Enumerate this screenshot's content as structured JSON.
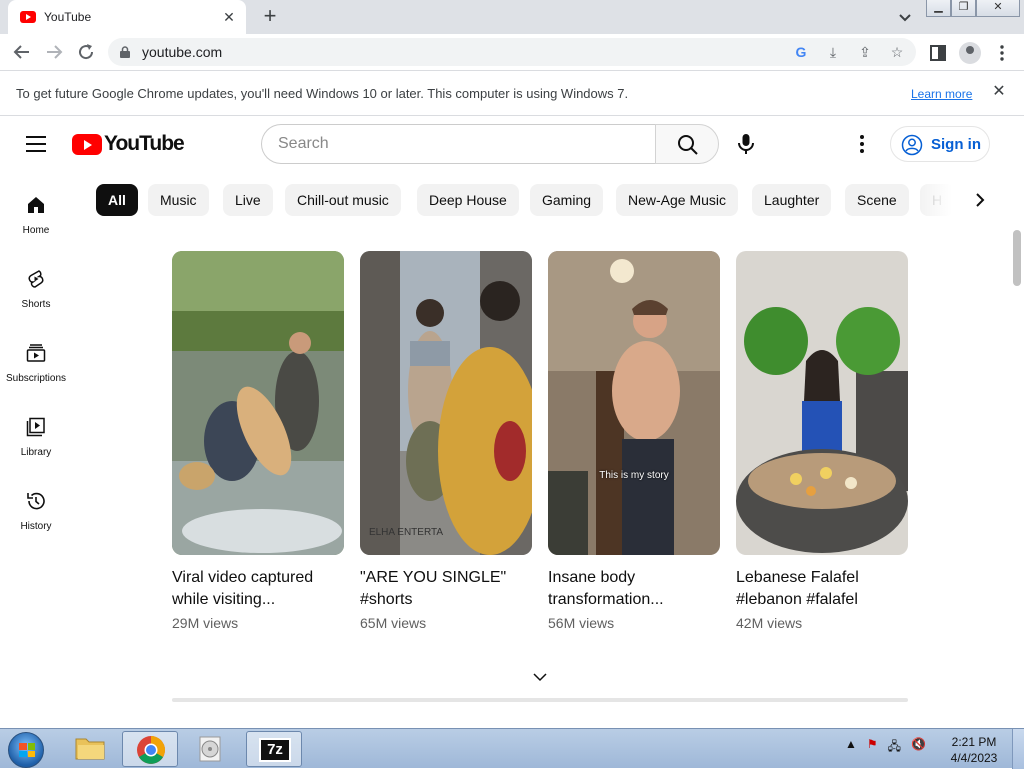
{
  "browser": {
    "tab_title": "YouTube",
    "url": "youtube.com",
    "new_tab_label": "+",
    "close_tab_label": "✕"
  },
  "infobar": {
    "message": "To get future Google Chrome updates, you'll need Windows 10 or later. This computer is using Windows 7.",
    "learn_more": "Learn more",
    "close_label": "✕"
  },
  "youtube": {
    "logo_text": "YouTube",
    "search_placeholder": "Search",
    "sign_in": "Sign in",
    "guide": [
      {
        "label": "Home",
        "icon": "home-icon"
      },
      {
        "label": "Shorts",
        "icon": "shorts-icon"
      },
      {
        "label": "Subscriptions",
        "icon": "subscriptions-icon"
      },
      {
        "label": "Library",
        "icon": "library-icon"
      },
      {
        "label": "History",
        "icon": "history-icon"
      }
    ],
    "chips": [
      "All",
      "Music",
      "Live",
      "Chill-out music",
      "Deep House",
      "Gaming",
      "New-Age Music",
      "Laughter",
      "Scene",
      "H"
    ],
    "shorts": [
      {
        "title": "Viral video captured while visiting...",
        "views": "29M views"
      },
      {
        "title": "\"ARE YOU SINGLE\" #shorts",
        "views": "65M views",
        "overlay": "ELHA ENTERTA"
      },
      {
        "title": "Insane body transformation...",
        "views": "56M views",
        "overlay": "This is my story"
      },
      {
        "title": "Lebanese Falafel #lebanon #falafel",
        "views": "42M views"
      }
    ]
  },
  "taskbar": {
    "time": "2:21 PM",
    "date": "4/4/2023",
    "app_7z_label": "7z"
  },
  "colors": {
    "youtube_red": "#ff0000",
    "link_blue": "#065fd4",
    "chip_bg": "#f2f2f2",
    "chip_active_bg": "#0f0f0f"
  }
}
